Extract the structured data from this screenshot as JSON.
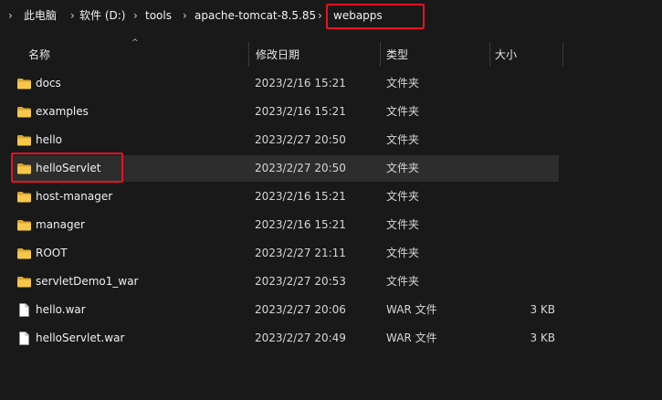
{
  "breadcrumb": {
    "items": [
      "此电脑",
      "软件 (D:)",
      "tools",
      "apache-tomcat-8.5.85",
      "webapps"
    ],
    "separator": "›"
  },
  "columns": {
    "name": "名称",
    "modified": "修改日期",
    "type": "类型",
    "size": "大小"
  },
  "files": [
    {
      "name": "docs",
      "modified": "2023/2/16 15:21",
      "type": "文件夹",
      "size": "",
      "icon": "folder-icon"
    },
    {
      "name": "examples",
      "modified": "2023/2/16 15:21",
      "type": "文件夹",
      "size": "",
      "icon": "folder-icon"
    },
    {
      "name": "hello",
      "modified": "2023/2/27 20:50",
      "type": "文件夹",
      "size": "",
      "icon": "folder-icon"
    },
    {
      "name": "helloServlet",
      "modified": "2023/2/27 20:50",
      "type": "文件夹",
      "size": "",
      "icon": "folder-icon",
      "selected": true,
      "annotated": true
    },
    {
      "name": "host-manager",
      "modified": "2023/2/16 15:21",
      "type": "文件夹",
      "size": "",
      "icon": "folder-icon"
    },
    {
      "name": "manager",
      "modified": "2023/2/16 15:21",
      "type": "文件夹",
      "size": "",
      "icon": "folder-icon"
    },
    {
      "name": "ROOT",
      "modified": "2023/2/27 21:11",
      "type": "文件夹",
      "size": "",
      "icon": "folder-icon"
    },
    {
      "name": "servletDemo1_war",
      "modified": "2023/2/27 20:53",
      "type": "文件夹",
      "size": "",
      "icon": "folder-icon"
    },
    {
      "name": "hello.war",
      "modified": "2023/2/27 20:06",
      "type": "WAR 文件",
      "size": "3 KB",
      "icon": "file-icon"
    },
    {
      "name": "helloServlet.war",
      "modified": "2023/2/27 20:49",
      "type": "WAR 文件",
      "size": "3 KB",
      "icon": "file-icon"
    }
  ],
  "colors": {
    "background": "#191919",
    "selected_row": "#2d2d2d",
    "annotation": "#e81123",
    "folder": "#f6c74a"
  }
}
